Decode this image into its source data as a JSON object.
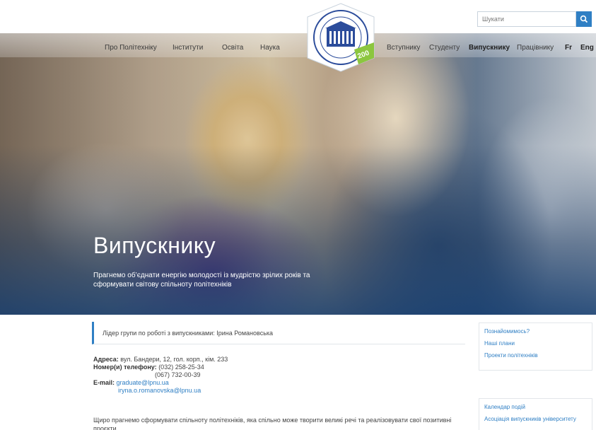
{
  "search": {
    "placeholder": "Шукати"
  },
  "nav": {
    "left": [
      "Про Політехніку",
      "Інститути",
      "Освіта",
      "Наука"
    ],
    "right": [
      "Вступнику",
      "Студенту",
      "Випускнику",
      "Працівнику",
      "Fr",
      "Eng"
    ],
    "active": "Випускнику"
  },
  "logo": {
    "arc_text": "НАЦІОНАЛЬНИЙ УНІВЕРСИТЕТ ЛЬВІВСЬКА ПОЛІТЕХНІКА",
    "motto": "ЛІТТЕРИС ЕТ АРТІБУС",
    "year": "200"
  },
  "hero": {
    "title": "Випускнику",
    "subtitle": "Прагнемо об’єднати енергію молодості із мудрістю зрілих років та сформувати світову спільноту політехніків"
  },
  "leader": {
    "text": "Лідер групи по роботі з випускниками: Ірина Романовська"
  },
  "contacts": {
    "address_label": "Адреса:",
    "address_value": "вул. Бандери, 12, гол. корп., кім. 233",
    "phone_label": "Номер(и) телефону:",
    "phone_1": "(032) 258-25-34",
    "phone_2": "(067) 732-00-39",
    "email_label": "E-mail:",
    "email_1": "graduate@lpnu.ua",
    "email_2": "iryna.o.romanovska@lpnu.ua"
  },
  "intro": {
    "text": "Щиро прагнемо сформувати спільноту політехніків, яка спільно може творити великі речі та реалізовувати свої позитивні проєкти"
  },
  "sidebar": {
    "group1": [
      "Познайомимось?",
      "Наші плани",
      "Проекти політехніків"
    ],
    "group2": [
      "Календар подій",
      "Асоціація випускників університету"
    ]
  },
  "colors": {
    "accent": "#2f7fc4",
    "link": "#2f7fc4",
    "logo_blue": "#2b4c9b",
    "logo_green": "#8cc63f"
  }
}
